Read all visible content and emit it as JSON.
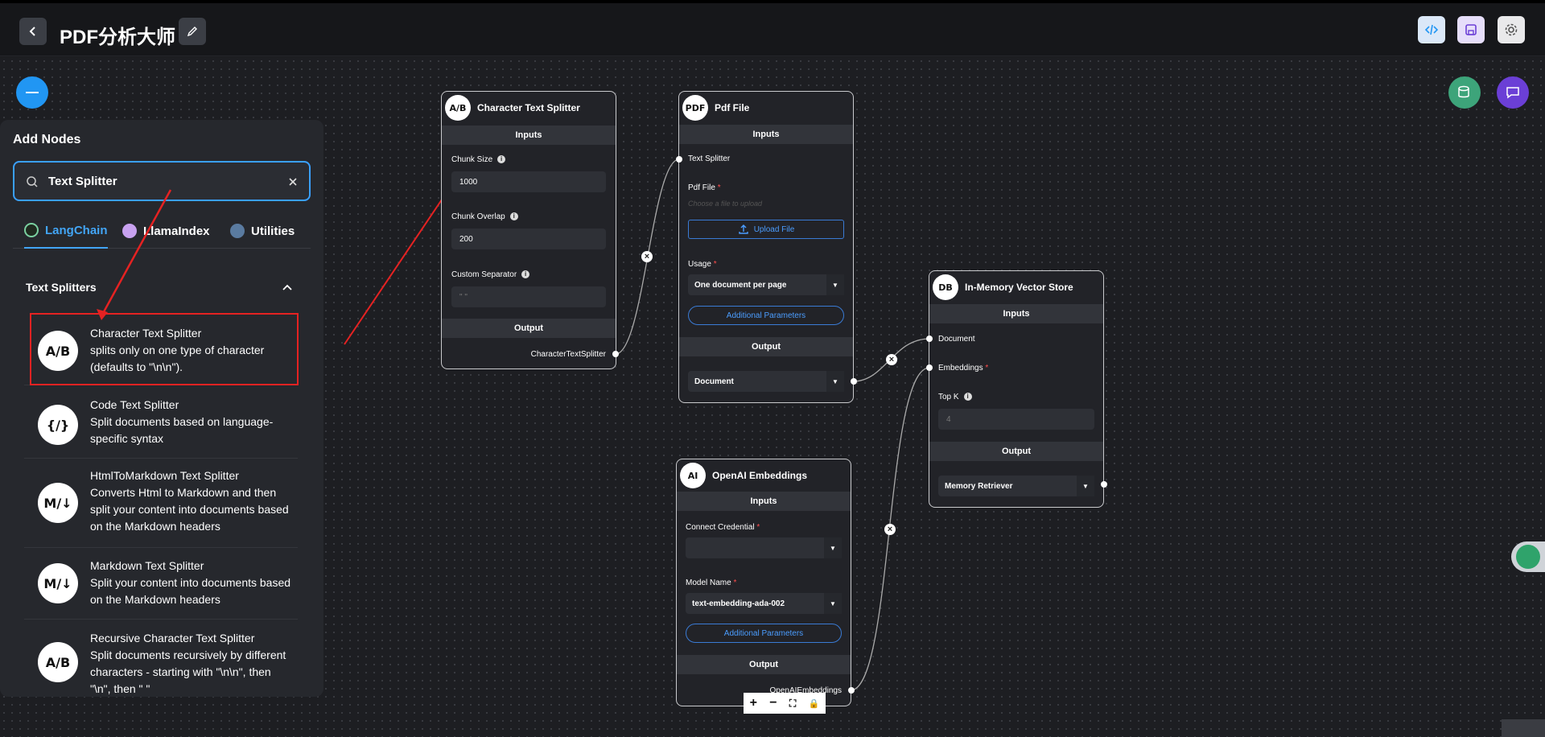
{
  "header": {
    "title": "PDF分析大师",
    "back_icon": "chevron-left-icon",
    "edit_icon": "pencil-icon",
    "code_icon": "code-icon",
    "save_icon": "save-icon",
    "settings_icon": "gear-icon"
  },
  "fabs": {
    "collapse_icon": "minus-icon",
    "upsert_icon": "database-upload-icon",
    "chat_icon": "chat-icon"
  },
  "add_nodes": {
    "title": "Add Nodes",
    "search_value": "Text Splitter",
    "tabs": [
      {
        "label": "LangChain",
        "active": true
      },
      {
        "label": "LlamaIndex",
        "active": false
      },
      {
        "label": "Utilities",
        "active": false
      }
    ],
    "section": "Text Splitters",
    "items": [
      {
        "icon": "A/B",
        "title": "Character Text Splitter",
        "desc": "splits only on one type of character (defaults to \"\\n\\n\")."
      },
      {
        "icon": "{/}",
        "title": "Code Text Splitter",
        "desc": "Split documents based on language-specific syntax"
      },
      {
        "icon": "M/↓",
        "title": "HtmlToMarkdown Text Splitter",
        "desc": "Converts Html to Markdown and then split your content into documents based on the Markdown headers"
      },
      {
        "icon": "M/↓",
        "title": "Markdown Text Splitter",
        "desc": "Split your content into documents based on the Markdown headers"
      },
      {
        "icon": "A/B",
        "title": "Recursive Character Text Splitter",
        "desc": "Split documents recursively by different characters - starting with \"\\n\\n\", then \"\\n\", then \" \""
      }
    ]
  },
  "nodes": {
    "char_splitter": {
      "icon": "A/B",
      "title": "Character Text Splitter",
      "inputs": "Inputs",
      "chunk_size_label": "Chunk Size",
      "chunk_size": "1000",
      "chunk_overlap_label": "Chunk Overlap",
      "chunk_overlap": "200",
      "separator_label": "Custom Separator",
      "separator_placeholder": "\" \"",
      "output": "Output",
      "output_name": "CharacterTextSplitter"
    },
    "pdf_file": {
      "icon": "PDF",
      "title": "Pdf File",
      "inputs": "Inputs",
      "text_splitter_label": "Text Splitter",
      "pdf_file_label": "Pdf File",
      "file_placeholder": "Choose a file to upload",
      "upload_label": "Upload File",
      "usage_label": "Usage",
      "usage_value": "One document per page",
      "additional": "Additional Parameters",
      "output": "Output",
      "output_value": "Document"
    },
    "vector_store": {
      "icon": "DB",
      "title": "In-Memory Vector Store",
      "inputs": "Inputs",
      "document_label": "Document",
      "embeddings_label": "Embeddings",
      "topk_label": "Top K",
      "topk_placeholder": "4",
      "output": "Output",
      "output_value": "Memory Retriever"
    },
    "openai_embeddings": {
      "icon": "AI",
      "title": "OpenAI Embeddings",
      "inputs": "Inputs",
      "credential_label": "Connect Credential",
      "model_label": "Model Name",
      "model_value": "text-embedding-ada-002",
      "additional": "Additional Parameters",
      "output": "Output",
      "output_name": "OpenAIEmbeddings"
    }
  },
  "controls": {
    "zoom_in": "+",
    "zoom_out": "−",
    "fit": "⛶",
    "lock": "🔒"
  },
  "colors": {
    "accent": "#2196f3",
    "highlight": "#e52222",
    "fab_green": "#3da47a",
    "fab_purple": "#6b3fd6"
  }
}
